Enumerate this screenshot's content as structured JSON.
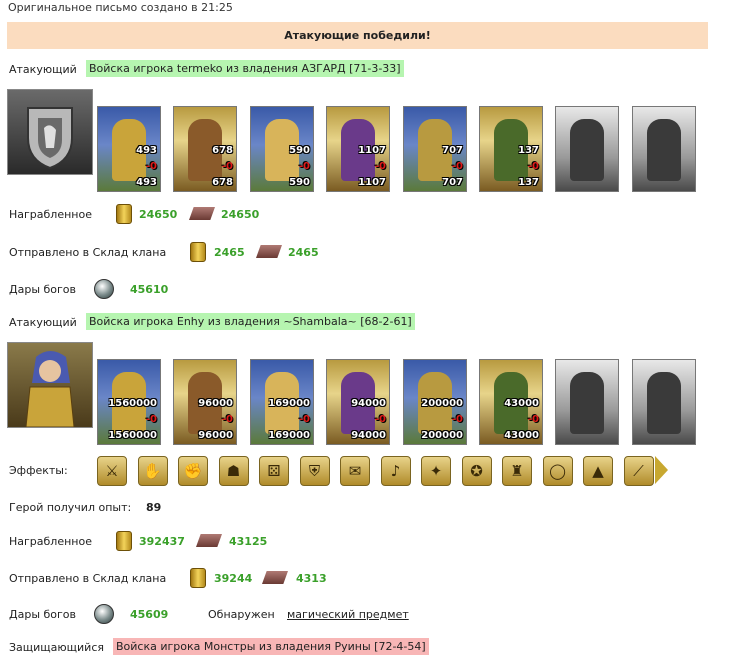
{
  "header": {
    "created": "Оригинальное письмо создано в 21:25"
  },
  "banner": {
    "result": "Атакующие победили!"
  },
  "attacker1": {
    "label": "Атакующий",
    "army": "Войска игрока termeko из владения АЗГАРД [71-3-33]",
    "units": [
      {
        "icon": "cavalry-unit-icon",
        "top": "493",
        "loss": "-0",
        "bottom": "493"
      },
      {
        "icon": "paladin-unit-icon",
        "top": "678",
        "loss": "-0",
        "bottom": "678"
      },
      {
        "icon": "knight-unit-icon",
        "top": "590",
        "loss": "-0",
        "bottom": "590"
      },
      {
        "icon": "griffin-unit-icon",
        "top": "1107",
        "loss": "-0",
        "bottom": "1107"
      },
      {
        "icon": "crossbowman-unit-icon",
        "top": "707",
        "loss": "-0",
        "bottom": "707"
      },
      {
        "icon": "monk-unit-icon",
        "top": "137",
        "loss": "-0",
        "bottom": "137"
      }
    ],
    "loot_label": "Награбленное",
    "loot_gold": "24650",
    "loot_ore": "24650",
    "clan_label": "Отправлено в Склад клана",
    "clan_gold": "2465",
    "clan_ore": "2465",
    "gifts_label": "Дары богов",
    "gifts_value": "45610"
  },
  "attacker2": {
    "label": "Атакующий",
    "army": "Войска игрока Enhy из владения ~Shambala~ [68-2-61]",
    "units": [
      {
        "icon": "minotaur-unit-icon",
        "top": "1560000",
        "loss": "-0",
        "bottom": "1560000"
      },
      {
        "icon": "assassin-unit-icon",
        "top": "96000",
        "loss": "-0",
        "bottom": "96000"
      },
      {
        "icon": "dragon-unit-icon",
        "top": "169000",
        "loss": "-0",
        "bottom": "169000"
      },
      {
        "icon": "harpy-unit-icon",
        "top": "94000",
        "loss": "-0",
        "bottom": "94000"
      },
      {
        "icon": "archer-unit-icon",
        "top": "200000",
        "loss": "-0",
        "bottom": "200000"
      },
      {
        "icon": "warlock-unit-icon",
        "top": "43000",
        "loss": "-0",
        "bottom": "43000"
      }
    ],
    "effects_label": "Эффекты:",
    "effects": [
      {
        "icon": "sword-effect-icon",
        "glyph": "⚔"
      },
      {
        "icon": "handshake-effect-icon",
        "glyph": "✋"
      },
      {
        "icon": "fist-effect-icon",
        "glyph": "✊"
      },
      {
        "icon": "helmet-effect-icon",
        "glyph": "☗"
      },
      {
        "icon": "dice-effect-icon",
        "glyph": "⚄"
      },
      {
        "icon": "shield-effect-icon",
        "glyph": "⛨"
      },
      {
        "icon": "scroll-effect-icon",
        "glyph": "✉"
      },
      {
        "icon": "horn-effect-icon",
        "glyph": "♪"
      },
      {
        "icon": "claw-effect-icon",
        "glyph": "✦"
      },
      {
        "icon": "pentagram-effect-icon",
        "glyph": "✪"
      },
      {
        "icon": "armor-effect-icon",
        "glyph": "♜"
      },
      {
        "icon": "ring-effect-icon",
        "glyph": "◯"
      },
      {
        "icon": "tent-effect-icon",
        "glyph": "▲"
      },
      {
        "icon": "blade-effect-icon",
        "glyph": "⟋"
      }
    ],
    "xp_label": "Герой получил опыт:",
    "xp_value": "89",
    "loot_label": "Награбленное",
    "loot_gold": "392437",
    "loot_ore": "43125",
    "clan_label": "Отправлено в Склад клана",
    "clan_gold": "39244",
    "clan_ore": "4313",
    "gifts_label": "Дары богов",
    "gifts_value": "45609",
    "found_label": "Обнаружен",
    "found_link": "магический предмет"
  },
  "defender": {
    "label": "Защищающийся",
    "army": "Войска игрока Монстры из владения Руины [72-4-54]"
  }
}
